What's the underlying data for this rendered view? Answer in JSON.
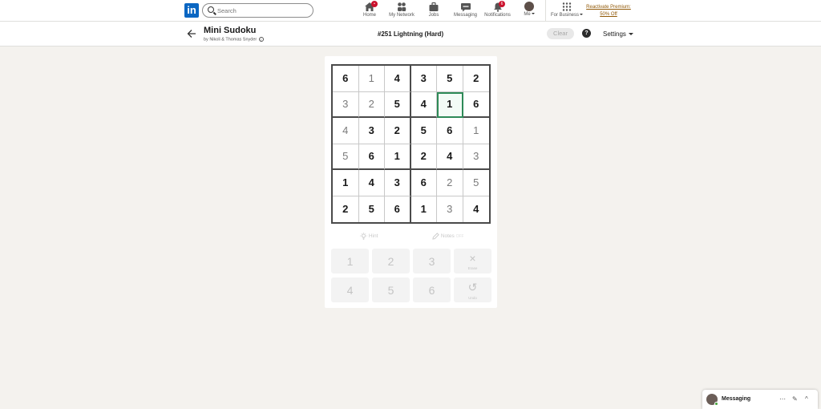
{
  "nav": {
    "logo": "in",
    "search_placeholder": "Search",
    "items": [
      {
        "label": "Home",
        "icon": "home-icon",
        "badge": "•"
      },
      {
        "label": "My Network",
        "icon": "network-icon"
      },
      {
        "label": "Jobs",
        "icon": "briefcase-icon"
      },
      {
        "label": "Messaging",
        "icon": "chat-icon"
      },
      {
        "label": "Notifications",
        "icon": "bell-icon",
        "badge": "6"
      },
      {
        "label": "Me",
        "icon": "avatar"
      },
      {
        "label": "For Business",
        "icon": "grid-icon"
      }
    ],
    "premium_line1": "Reactivate Premium:",
    "premium_line2": "50% Off"
  },
  "game": {
    "title": "Mini Sudoku",
    "byline": "by Nikoli & Thomas Snyder",
    "info_icon": "ⓘ",
    "puzzle_id": "#251 Lightning (Hard)",
    "clear_label": "Clear",
    "help_label": "?",
    "settings_label": "Settings",
    "board": [
      [
        {
          "v": "6",
          "t": "given"
        },
        {
          "v": "1",
          "t": "filled"
        },
        {
          "v": "4",
          "t": "given"
        },
        {
          "v": "3",
          "t": "given"
        },
        {
          "v": "5",
          "t": "given"
        },
        {
          "v": "2",
          "t": "given"
        }
      ],
      [
        {
          "v": "3",
          "t": "filled"
        },
        {
          "v": "2",
          "t": "filled"
        },
        {
          "v": "5",
          "t": "given"
        },
        {
          "v": "4",
          "t": "given"
        },
        {
          "v": "1",
          "t": "selected"
        },
        {
          "v": "6",
          "t": "given"
        }
      ],
      [
        {
          "v": "4",
          "t": "filled"
        },
        {
          "v": "3",
          "t": "given"
        },
        {
          "v": "2",
          "t": "given"
        },
        {
          "v": "5",
          "t": "given"
        },
        {
          "v": "6",
          "t": "given"
        },
        {
          "v": "1",
          "t": "filled"
        }
      ],
      [
        {
          "v": "5",
          "t": "filled"
        },
        {
          "v": "6",
          "t": "given"
        },
        {
          "v": "1",
          "t": "given"
        },
        {
          "v": "2",
          "t": "given"
        },
        {
          "v": "4",
          "t": "given"
        },
        {
          "v": "3",
          "t": "filled"
        }
      ],
      [
        {
          "v": "1",
          "t": "given"
        },
        {
          "v": "4",
          "t": "given"
        },
        {
          "v": "3",
          "t": "given"
        },
        {
          "v": "6",
          "t": "given"
        },
        {
          "v": "2",
          "t": "filled"
        },
        {
          "v": "5",
          "t": "filled"
        }
      ],
      [
        {
          "v": "2",
          "t": "given"
        },
        {
          "v": "5",
          "t": "given"
        },
        {
          "v": "6",
          "t": "given"
        },
        {
          "v": "1",
          "t": "given"
        },
        {
          "v": "3",
          "t": "filled"
        },
        {
          "v": "4",
          "t": "given"
        }
      ]
    ],
    "hint_label": "Hint",
    "notes_label": "Notes",
    "notes_state": "OFF",
    "keypad": [
      {
        "label": "1",
        "name": "key-1"
      },
      {
        "label": "2",
        "name": "key-2"
      },
      {
        "label": "3",
        "name": "key-3"
      },
      {
        "label": "×",
        "sub": "Erase",
        "name": "erase-button"
      },
      {
        "label": "4",
        "name": "key-4"
      },
      {
        "label": "5",
        "name": "key-5"
      },
      {
        "label": "6",
        "name": "key-6"
      },
      {
        "label": "↺",
        "sub": "Undo",
        "name": "undo-button"
      }
    ]
  },
  "messaging": {
    "title": "Messaging",
    "more": "⋯",
    "compose": "✎",
    "collapse": "^"
  }
}
